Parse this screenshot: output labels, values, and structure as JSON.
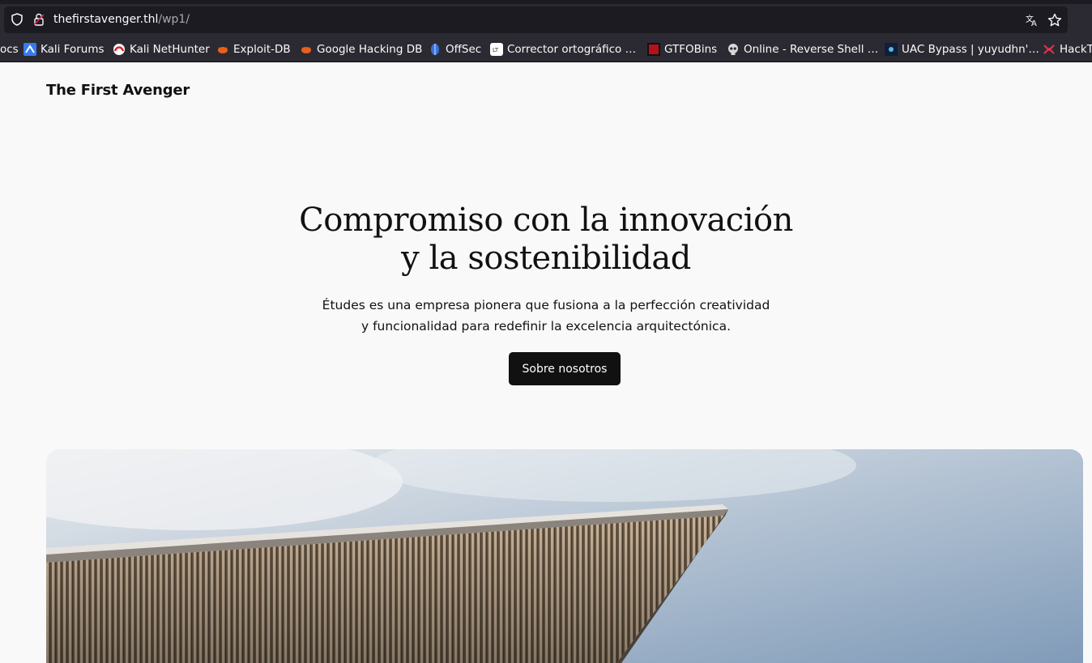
{
  "browser": {
    "url_host": "thefirstavenger.thl",
    "url_path": "/wp1/",
    "bookmarks": [
      {
        "label": "ocs",
        "icon": "generic-icon"
      },
      {
        "label": "Kali Forums",
        "icon": "kali-dragon-icon"
      },
      {
        "label": "Kali NetHunter",
        "icon": "nethunter-icon"
      },
      {
        "label": "Exploit-DB",
        "icon": "exploitdb-bug-icon"
      },
      {
        "label": "Google Hacking DB",
        "icon": "ghdb-bug-icon"
      },
      {
        "label": "OffSec",
        "icon": "offsec-icon"
      },
      {
        "label": "Corrector ortográfico …",
        "icon": "languagetool-icon"
      },
      {
        "label": "GTFOBins",
        "icon": "gtfobins-icon"
      },
      {
        "label": "Online - Reverse Shell …",
        "icon": "skull-icon"
      },
      {
        "label": "UAC Bypass | yuyudhn'…",
        "icon": "uac-icon"
      },
      {
        "label": "HackT",
        "icon": "hacktricks-icon"
      }
    ]
  },
  "site": {
    "title": "The First Avenger"
  },
  "hero": {
    "heading_line1": "Compromiso con la innovación",
    "heading_line2": "y la sostenibilidad",
    "sub_line1": "Études es una empresa pionera que fusiona a la perfección creatividad",
    "sub_line2": "y funcionalidad para redefinir la excelencia arquitectónica.",
    "button_label": "Sobre nosotros"
  },
  "colors": {
    "chrome_bg": "#2b2a33",
    "page_bg": "#f9f9f9",
    "button_bg": "#111111",
    "sky": "#8fa9c4"
  }
}
